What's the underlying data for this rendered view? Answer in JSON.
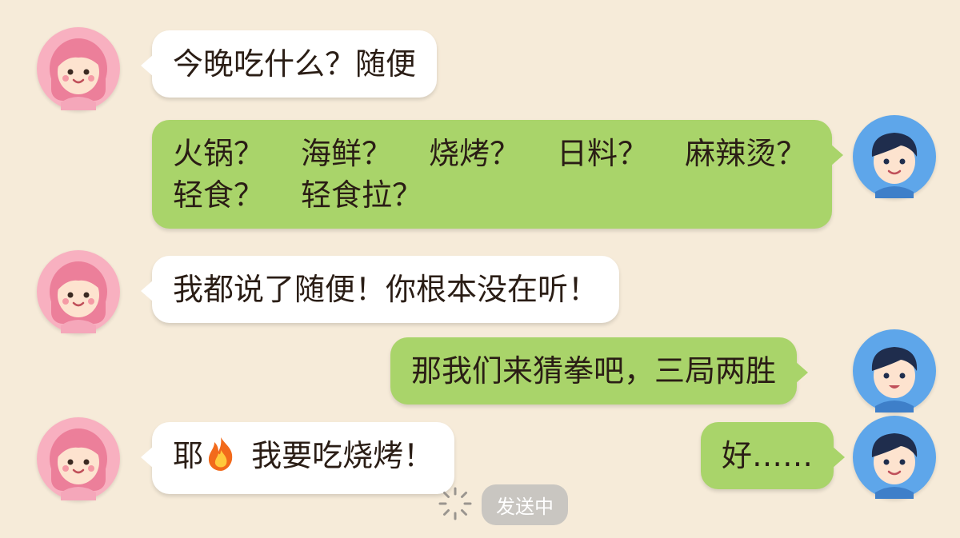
{
  "messages": [
    {
      "sender": "girl",
      "text": "今晚吃什么？随便"
    },
    {
      "sender": "boy",
      "options": [
        "火锅？",
        "海鲜？",
        "烧烤？",
        "日料？",
        "麻辣烫？",
        "轻食？",
        "轻食拉？"
      ]
    },
    {
      "sender": "girl",
      "text": "我都说了随便！你根本没在听！"
    },
    {
      "sender": "boy",
      "text": "那我们来猜拳吧，三局两胜"
    },
    {
      "sender": "girl",
      "text_before": "耶",
      "emoji": "fire-emoji",
      "text_after": " 我要吃烧烤！"
    },
    {
      "sender": "boy",
      "text": "好……"
    }
  ],
  "status": {
    "label": "发送中",
    "icon": "loading-spinner-icon"
  },
  "colors": {
    "background": "#f6ebd9",
    "left_bubble": "#ffffff",
    "right_bubble": "#a9d46a",
    "girl_avatar": "#f8b0c0",
    "boy_avatar": "#5ea6ea"
  }
}
